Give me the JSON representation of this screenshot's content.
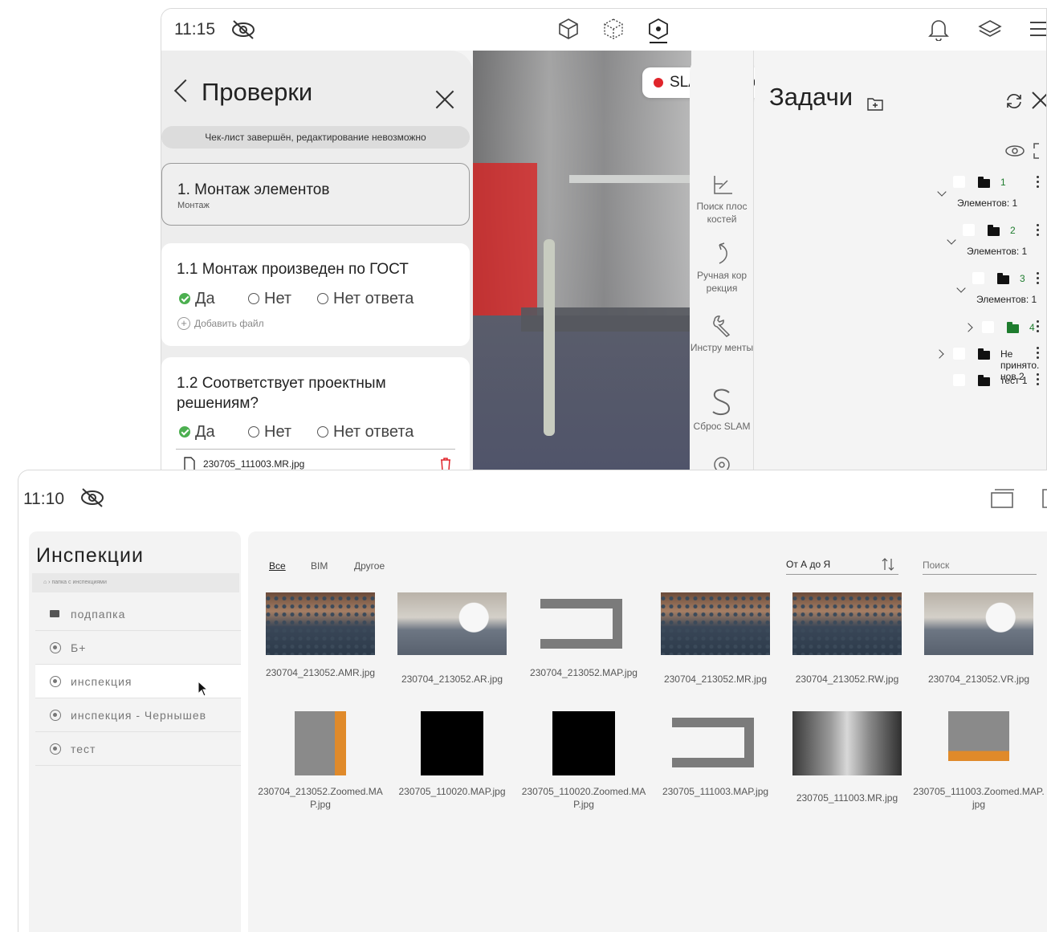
{
  "top_window": {
    "time": "11:15",
    "slam_status": "SLAM потерян",
    "checks": {
      "title": "Проверки",
      "note": "Чек-лист завершён, редактирование невозможно",
      "section": {
        "title": "1. Монтаж элементов",
        "subtitle": "Монтаж"
      },
      "questions": [
        {
          "title": "1.1 Монтаж произведен по ГОСТ",
          "options": [
            "Да",
            "Нет",
            "Нет ответа"
          ],
          "selected": "Да",
          "add_file": "Добавить файл"
        },
        {
          "title": "1.2 Соответствует проектным решениям?",
          "options": [
            "Да",
            "Нет",
            "Нет ответа"
          ],
          "selected": "Да",
          "file": "230705_111003.MR.jpg"
        }
      ]
    },
    "tools": [
      {
        "label": "Поиск плос костей",
        "icon": "plane-search-icon"
      },
      {
        "label": "Ручная кор рекция",
        "icon": "manual-correction-icon"
      },
      {
        "label": "Инстру менты",
        "icon": "tools-icon"
      },
      {
        "label": "Сброс SLAM",
        "icon": "slam-reset-icon"
      }
    ],
    "tasks": {
      "title": "Задачи",
      "tree": [
        {
          "name": "1",
          "count": "Элементов: 1",
          "green": true
        },
        {
          "name": "2",
          "count": "Элементов: 1",
          "green": true
        },
        {
          "name": "3",
          "count": "Элементов: 1",
          "green": true
        },
        {
          "name": "4",
          "green": true
        },
        {
          "name": "Не принято. нов 2"
        },
        {
          "name": "тест 1"
        }
      ]
    }
  },
  "bottom_window": {
    "time": "11:10",
    "inspections": {
      "title": "Инспекции",
      "breadcrumb": "папка с инспекциями",
      "items": [
        "подпапка",
        "Б+",
        "инспекция",
        "инспекция - Чернышев",
        "тест"
      ],
      "selected_index": 2
    },
    "gallery": {
      "tabs": [
        "Все",
        "BIM",
        "Другое"
      ],
      "active_tab": "Все",
      "sort": "От А до Я",
      "search_placeholder": "Поиск",
      "items": [
        "230704_213052.AMR.jpg",
        "230704_213052.AR.jpg",
        "230704_213052.MAP.jpg",
        "230704_213052.MR.jpg",
        "230704_213052.RW.jpg",
        "230704_213052.VR.jpg",
        "230704_213052.Zoomed.MAP.jpg",
        "230705_110020.MAP.jpg",
        "230705_110020.Zoomed.MAP.jpg",
        "230705_111003.MAP.jpg",
        "230705_111003.MR.jpg",
        "230705_111003.Zoomed.MAP.jpg"
      ]
    }
  },
  "colors": {
    "green": "#4caf50",
    "red_dot": "#e0252b",
    "folder_green": "#1e7c2e"
  }
}
